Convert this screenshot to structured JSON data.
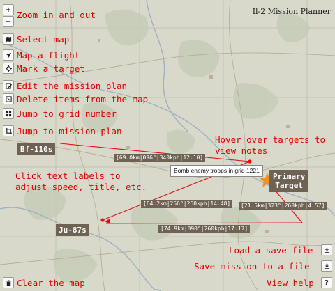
{
  "app_title": "Il-2 Mission Planner",
  "toolbar": [
    {
      "icon": "zoom-in-icon",
      "glyph": "+"
    },
    {
      "icon": "zoom-out-icon",
      "glyph": "−"
    },
    {
      "icon": "map-icon",
      "glyph": ""
    },
    {
      "icon": "plane-icon",
      "glyph": ""
    },
    {
      "icon": "target-icon",
      "glyph": ""
    },
    {
      "icon": "edit-icon",
      "glyph": ""
    },
    {
      "icon": "delete-icon",
      "glyph": ""
    },
    {
      "icon": "grid-icon",
      "glyph": ""
    },
    {
      "icon": "crop-icon",
      "glyph": ""
    },
    {
      "icon": "trash-icon",
      "glyph": ""
    }
  ],
  "hints": {
    "zoom": "Zoom in and out",
    "select_map": "Select map",
    "map_flight": "Map a flight",
    "mark_target": "Mark a target",
    "edit_plan": "Edit the mission plan",
    "delete_items": "Delete items from the map",
    "jump_grid": "Jump to grid number",
    "jump_plan": "Jump to mission plan",
    "hover_notes_1": "Hover over targets to",
    "hover_notes_2": "view notes",
    "click_labels_1": "Click text labels to",
    "click_labels_2": "adjust speed, title, etc.",
    "load_save": "Load a save file",
    "save_mission": "Save mission to a file",
    "view_help": "View help",
    "clear_map": "Clear the map"
  },
  "right_buttons": {
    "upload_icon": "upload-icon",
    "download_icon": "download-icon",
    "help_glyph": "?"
  },
  "flights": [
    {
      "name": "Bf-110s"
    },
    {
      "name": "Ju-87s"
    }
  ],
  "target": {
    "name_line1": "Primary",
    "name_line2": "Target",
    "note": "Bomb enemy troops in grid 1221"
  },
  "legs": [
    "[69.0km|096°|340kph|12:10]",
    "[21.5km|323°|260kph|4:57]",
    "[74.9km|090°|260kph|17:17]",
    "[64.2km|256°|260kph|14:48]"
  ],
  "colors": {
    "route": "#e01010",
    "hint": "#e00000",
    "label_bg": "#6e6254",
    "target_star": "#f0901e"
  }
}
